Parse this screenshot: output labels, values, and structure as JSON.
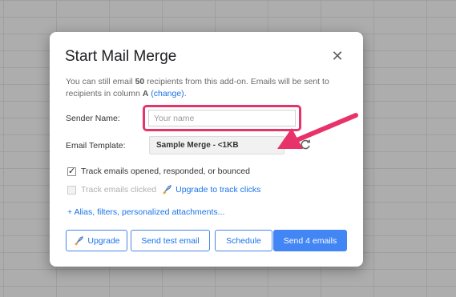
{
  "dialog": {
    "title": "Start Mail Merge",
    "close_icon": "close-icon",
    "info_prefix": "You can still email ",
    "info_count": "50",
    "info_middle": " recipients from this add-on. Emails will be sent to recipients in column ",
    "info_column": "A",
    "info_change": "(change)",
    "info_suffix": ".",
    "sender": {
      "label": "Sender Name:",
      "placeholder": "Your name",
      "value": ""
    },
    "template": {
      "label": "Email Template:",
      "value": "Sample Merge - <1KB",
      "refresh_icon": "refresh-icon"
    },
    "track_opened": {
      "label": "Track emails opened, responded, or bounced",
      "checked": true
    },
    "track_clicked": {
      "label": "Track emails clicked",
      "upgrade_link": "Upgrade to track clicks",
      "checked": false,
      "disabled": true
    },
    "more_options": "+ Alias, filters, personalized attachments...",
    "buttons": {
      "upgrade": "Upgrade",
      "send_test": "Send test email",
      "schedule": "Schedule",
      "send": "Send 4 emails"
    }
  },
  "colors": {
    "accent": "#4285f4",
    "highlight": "#e8336a",
    "link": "#1a73e8"
  }
}
